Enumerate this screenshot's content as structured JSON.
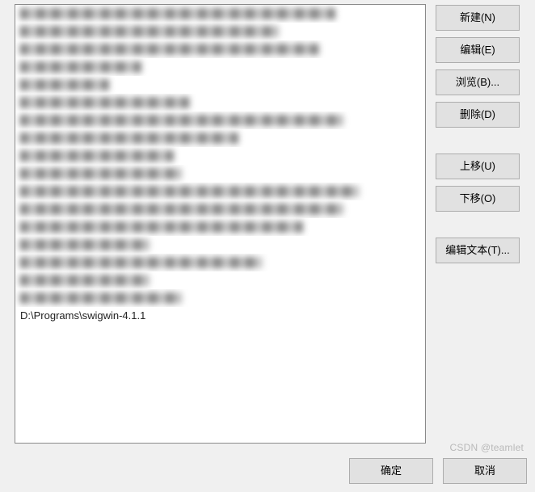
{
  "list": {
    "blurred_widths": [
      390,
      320,
      370,
      150,
      110,
      210,
      400,
      270,
      190,
      200,
      420,
      400,
      350,
      160,
      300,
      160,
      200
    ],
    "visible_item": "D:\\Programs\\swigwin-4.1.1"
  },
  "buttons": {
    "new": "新建(N)",
    "edit": "编辑(E)",
    "browse": "浏览(B)...",
    "delete": "删除(D)",
    "move_up": "上移(U)",
    "move_down": "下移(O)",
    "edit_text": "编辑文本(T)...",
    "ok": "确定",
    "cancel": "取消"
  },
  "watermark": "CSDN @teamlet"
}
